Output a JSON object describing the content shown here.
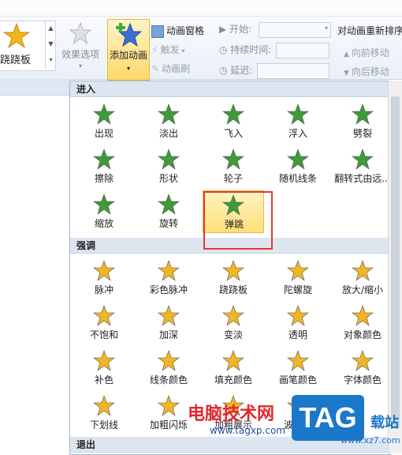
{
  "ribbon": {
    "gallery_label": "跷跷板",
    "effect_options": "效果选项",
    "add_animation": "添加动画",
    "animation_pane": "动画窗格",
    "trigger": "触发",
    "animation_painter": "动画刷",
    "start_label": "开始:",
    "duration_label": "持续时间:",
    "delay_label": "延迟:",
    "reorder_title": "对动画重新排序",
    "move_earlier": "向前移动",
    "move_later": "向后移动"
  },
  "dropdown": {
    "sections": {
      "entrance": "进入",
      "emphasis": "强调",
      "exit": "退出"
    },
    "entrance_items": [
      "出现",
      "淡出",
      "飞入",
      "浮入",
      "劈裂",
      "擦除",
      "形状",
      "轮子",
      "随机线条",
      "翻转式由远...",
      "缩放",
      "旋转",
      "弹跳"
    ],
    "emphasis_items": [
      "脉冲",
      "彩色脉冲",
      "跷跷板",
      "陀螺旋",
      "放大/缩小",
      "不饱和",
      "加深",
      "变淡",
      "透明",
      "对象颜色",
      "补色",
      "线条颜色",
      "填充颜色",
      "画笔颜色",
      "字体颜色",
      "下划线",
      "加粗闪烁",
      "加粗展示",
      "波浪形"
    ],
    "selected": "弹跳"
  },
  "colors": {
    "entrance_star": "#3e9a3a",
    "emphasis_star": "#f2b526",
    "selected_bg": "#ffdf7a",
    "highlight_box": "#e23a2e"
  },
  "watermark": {
    "site_cn": "电脑技术网",
    "url": "www.tagxp.com",
    "tag": "TAG",
    "suffix": "载站",
    "url2": "www.xz7.com"
  }
}
